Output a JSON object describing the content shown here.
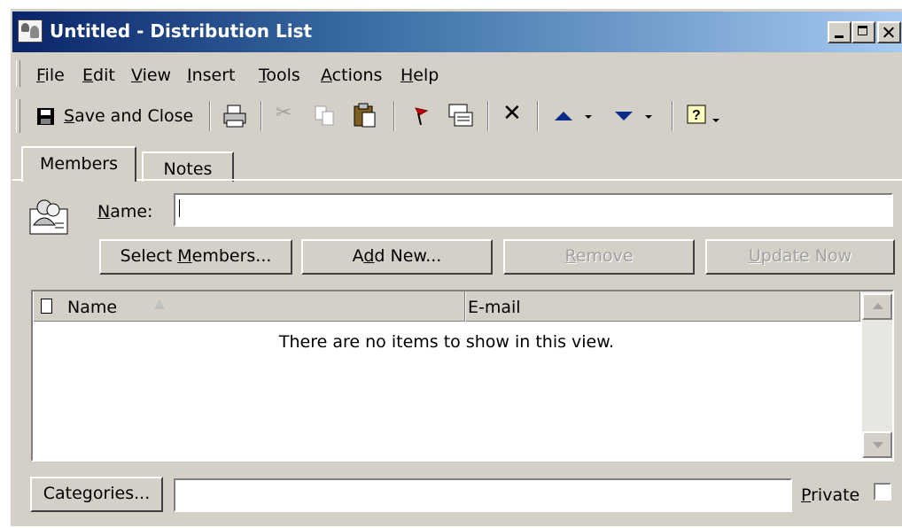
{
  "window": {
    "title": "Untitled - Distribution List"
  },
  "menu": [
    {
      "label": "File"
    },
    {
      "label": "Edit"
    },
    {
      "label": "View"
    },
    {
      "label": "Insert"
    },
    {
      "label": "Tools"
    },
    {
      "label": "Actions"
    },
    {
      "label": "Help"
    }
  ],
  "toolbar": {
    "save_close_prefix": "",
    "save_close_underlined": "S",
    "save_close_rest": "ave and Close",
    "icons": [
      "save-icon",
      "print-icon",
      "cut-icon",
      "copy-icon",
      "paste-icon",
      "flag-icon",
      "address-card-icon",
      "delete-icon",
      "previous-item-icon",
      "next-item-icon",
      "help-icon"
    ]
  },
  "tabs": [
    {
      "label": "Members",
      "active": true
    },
    {
      "label": "Notes",
      "active": false
    }
  ],
  "members": {
    "name_label_u": "N",
    "name_label_rest": "ame:",
    "name_value": "",
    "buttons": {
      "select_members_pre": "Select ",
      "select_members_u": "M",
      "select_members_post": "embers...",
      "add_new_pre": "A",
      "add_new_u": "d",
      "add_new_post": "d New...",
      "remove_u": "R",
      "remove_post": "emove",
      "update_now_u": "U",
      "update_now_post": "pdate Now"
    }
  },
  "list": {
    "columns": [
      "Name",
      "E-mail"
    ],
    "empty_message": "There are no items to show in this view."
  },
  "footer": {
    "categories_pre": "Cate",
    "categories_u": "g",
    "categories_post": "ories...",
    "categories_value": "",
    "private_u": "P",
    "private_post": "rivate",
    "private_checked": false
  }
}
